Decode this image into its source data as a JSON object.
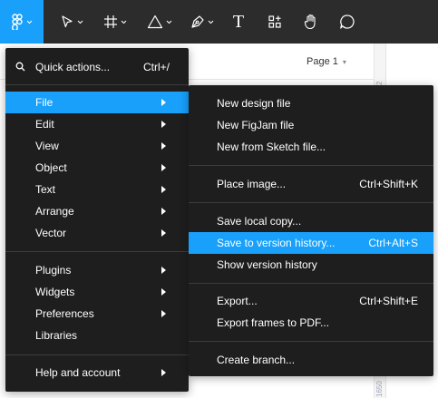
{
  "colors": {
    "accent": "#18a0fb",
    "toolbar_bg": "#2c2c2c",
    "menu_bg": "#1e1e1e"
  },
  "toolbar": {
    "tools": [
      "figma-menu-icon",
      "move-tool-icon",
      "frame-tool-icon",
      "shape-tool-icon",
      "pen-tool-icon",
      "text-tool-icon",
      "resources-icon",
      "hand-tool-icon",
      "comment-icon"
    ],
    "text_tool_glyph": "T"
  },
  "canvas": {
    "page_label": "Page 1",
    "ruler_top": "2",
    "ruler_bottom": "1650"
  },
  "main_menu": {
    "quick_actions": {
      "label": "Quick actions...",
      "shortcut": "Ctrl+/"
    },
    "items": [
      {
        "label": "File",
        "active": true,
        "submenu": true
      },
      {
        "label": "Edit",
        "submenu": true
      },
      {
        "label": "View",
        "submenu": true
      },
      {
        "label": "Object",
        "submenu": true
      },
      {
        "label": "Text",
        "submenu": true
      },
      {
        "label": "Arrange",
        "submenu": true
      },
      {
        "label": "Vector",
        "submenu": true
      },
      {
        "label": "Plugins",
        "submenu": true
      },
      {
        "label": "Widgets",
        "submenu": true
      },
      {
        "label": "Preferences",
        "submenu": true
      },
      {
        "label": "Libraries",
        "submenu": false
      },
      {
        "label": "Help and account",
        "submenu": true
      }
    ]
  },
  "file_menu": {
    "items": [
      {
        "label": "New design file",
        "shortcut": ""
      },
      {
        "label": "New FigJam file",
        "shortcut": ""
      },
      {
        "label": "New from Sketch file...",
        "shortcut": ""
      },
      {
        "label": "Place image...",
        "shortcut": "Ctrl+Shift+K"
      },
      {
        "label": "Save local copy...",
        "shortcut": ""
      },
      {
        "label": "Save to version history...",
        "shortcut": "Ctrl+Alt+S",
        "active": true
      },
      {
        "label": "Show version history",
        "shortcut": ""
      },
      {
        "label": "Export...",
        "shortcut": "Ctrl+Shift+E"
      },
      {
        "label": "Export frames to PDF...",
        "shortcut": ""
      },
      {
        "label": "Create branch...",
        "shortcut": ""
      }
    ]
  }
}
